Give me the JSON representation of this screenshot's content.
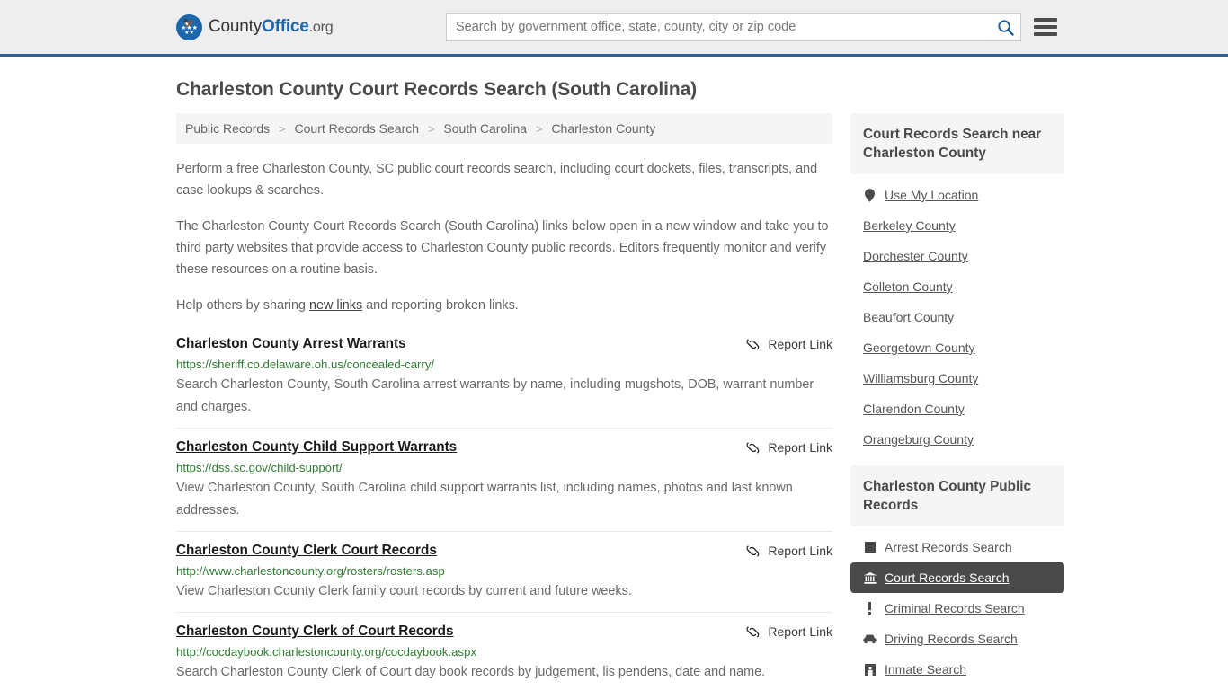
{
  "header": {
    "brand": {
      "part1": "County",
      "part2": "Office",
      "part3": ".org"
    },
    "search": {
      "placeholder": "Search by government office, state, county, city or zip code",
      "value": ""
    },
    "search_icon": "search-icon",
    "menu_icon": "hamburger-menu-icon",
    "accent_color": "#2a6496"
  },
  "main": {
    "title": "Charleston County Court Records Search (South Carolina)",
    "breadcrumb": [
      "Public Records",
      "Court Records Search",
      "South Carolina",
      "Charleston County"
    ],
    "breadcrumb_separator": ">",
    "paragraphs": {
      "p1": "Perform a free Charleston County, SC public court records search, including court dockets, files, transcripts, and case lookups & searches.",
      "p2": "The Charleston County Court Records Search (South Carolina) links below open in a new window and take you to third party websites that provide access to Charleston County public records. Editors frequently monitor and verify these resources on a routine basis.",
      "p3_before": "Help others by sharing ",
      "p3_link": "new links",
      "p3_after": " and reporting broken links."
    },
    "report_link_label": "Report Link",
    "results": [
      {
        "title": "Charleston County Arrest Warrants",
        "url": "https://sheriff.co.delaware.oh.us/concealed-carry/",
        "description": "Search Charleston County, South Carolina arrest warrants by name, including mugshots, DOB, warrant number and charges."
      },
      {
        "title": "Charleston County Child Support Warrants",
        "url": "https://dss.sc.gov/child-support/",
        "description": "View Charleston County, South Carolina child support warrants list, including names, photos and last known addresses."
      },
      {
        "title": "Charleston County Clerk Court Records",
        "url": "http://www.charlestoncounty.org/rosters/rosters.asp",
        "description": "View Charleston County Clerk family court records by current and future weeks."
      },
      {
        "title": "Charleston County Clerk of Court Records",
        "url": "http://cocdaybook.charlestoncounty.org/cocdaybook.aspx",
        "description": "Search Charleston County Clerk of Court day book records by judgement, lis pendens, date and name."
      }
    ]
  },
  "sidebar": {
    "nearby": {
      "heading": "Court Records Search near Charleston County",
      "items": [
        {
          "label": "Use My Location",
          "icon": "map-pin-icon"
        },
        {
          "label": "Berkeley County",
          "icon": ""
        },
        {
          "label": "Dorchester County",
          "icon": ""
        },
        {
          "label": "Colleton County",
          "icon": ""
        },
        {
          "label": "Beaufort County",
          "icon": ""
        },
        {
          "label": "Georgetown County",
          "icon": ""
        },
        {
          "label": "Williamsburg County",
          "icon": ""
        },
        {
          "label": "Clarendon County",
          "icon": ""
        },
        {
          "label": "Orangeburg County",
          "icon": ""
        }
      ]
    },
    "public_records": {
      "heading": "Charleston County Public Records",
      "active_index": 1,
      "items": [
        {
          "label": "Arrest Records Search",
          "icon": "square-icon"
        },
        {
          "label": "Court Records Search",
          "icon": "courthouse-icon"
        },
        {
          "label": "Criminal Records Search",
          "icon": "exclamation-icon"
        },
        {
          "label": "Driving Records Search",
          "icon": "car-icon"
        },
        {
          "label": "Inmate Search",
          "icon": "jail-icon"
        }
      ]
    }
  }
}
